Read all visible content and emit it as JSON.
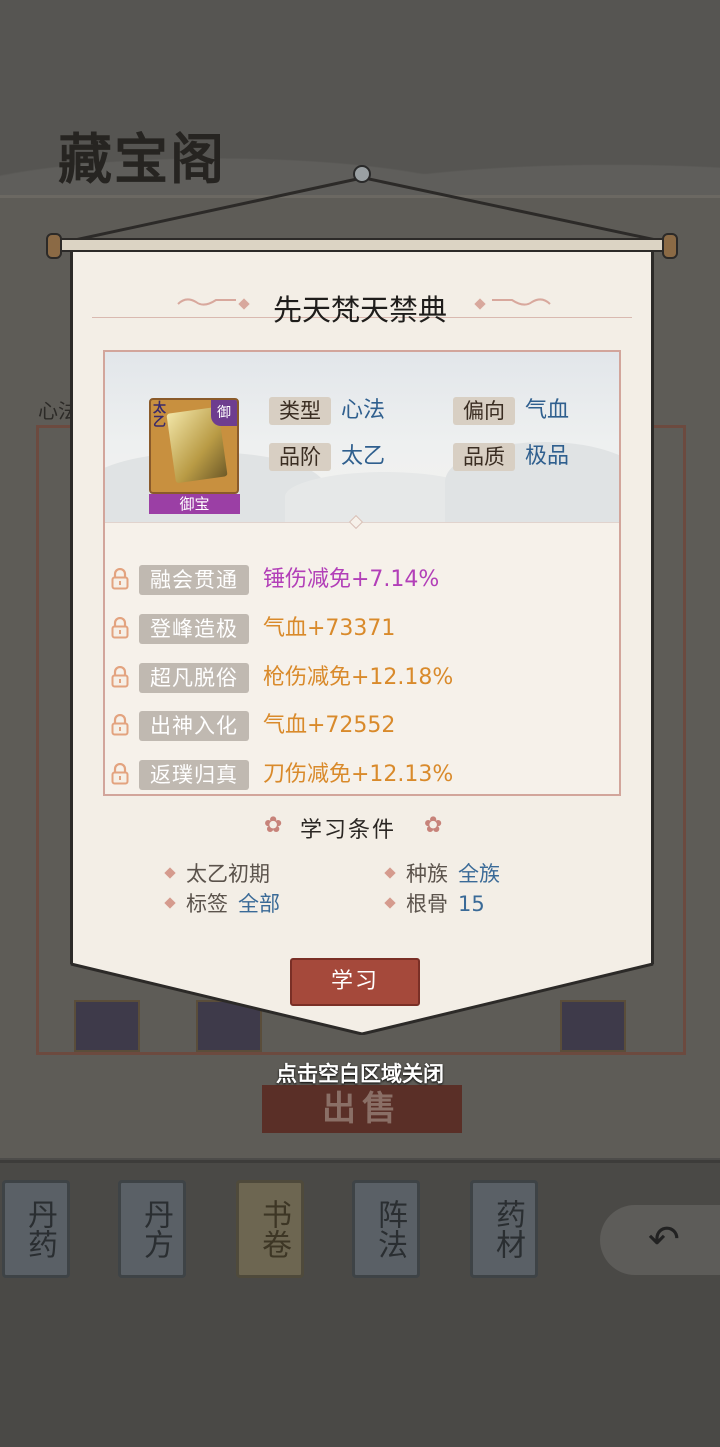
{
  "background": {
    "title": "藏宝阁",
    "side_label": "心法",
    "sell_button": "出售",
    "tabs": [
      "丹药",
      "丹方",
      "书卷",
      "阵法",
      "药材"
    ],
    "active_tab": "书卷",
    "back_icon": "back-arrow-icon"
  },
  "popup": {
    "title": "先天梵天禁典",
    "item": {
      "icon_corner_left": "太乙",
      "icon_corner_right": "御",
      "tag": "御宝"
    },
    "attributes": [
      {
        "label": "类型",
        "value": "心法"
      },
      {
        "label": "偏向",
        "value": "气血"
      },
      {
        "label": "品阶",
        "value": "太乙"
      },
      {
        "label": "品质",
        "value": "极品"
      }
    ],
    "skills": [
      {
        "name": "融会贯通",
        "effect": "锤伤减免+7.14%",
        "color": "#b23fb8"
      },
      {
        "name": "登峰造极",
        "effect": "气血+73371",
        "color": "#d98a2b"
      },
      {
        "name": "超凡脱俗",
        "effect": "枪伤减免+12.18%",
        "color": "#d98a2b"
      },
      {
        "name": "出神入化",
        "effect": "气血+72552",
        "color": "#d98a2b"
      },
      {
        "name": "返璞归真",
        "effect": "刀伤减免+12.13%",
        "color": "#d98a2b"
      }
    ],
    "requirements_title": "学习条件",
    "requirements": [
      {
        "key": "太乙初期",
        "value": ""
      },
      {
        "key": "种族",
        "value": "全族"
      },
      {
        "key": "标签",
        "value": "全部"
      },
      {
        "key": "根骨",
        "value": "15"
      }
    ],
    "learn_button": "学习",
    "close_hint": "点击空白区域关闭"
  }
}
